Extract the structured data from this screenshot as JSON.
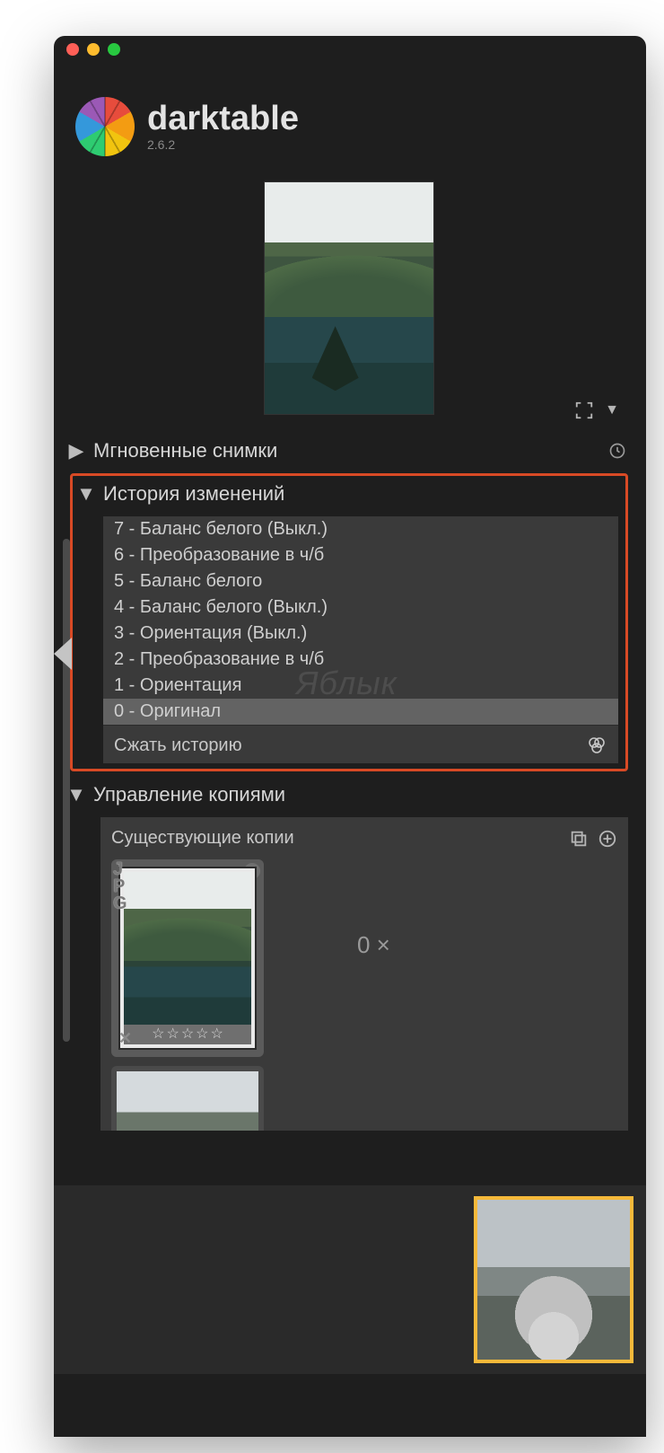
{
  "app": {
    "name": "darktable",
    "version": "2.6.2"
  },
  "panels": {
    "snapshots": {
      "title": "Мгновенные снимки",
      "expanded": false
    },
    "history": {
      "title": "История изменений",
      "expanded": true,
      "items": [
        "7 - Баланс белого (Выкл.)",
        "6 - Преобразование в ч/б",
        "5 - Баланс белого",
        "4 - Баланс белого (Выкл.)",
        "3 - Ориентация (Выкл.)",
        "2 - Преобразование в ч/б",
        "1 - Ориентация",
        "0 - Оригинал"
      ],
      "selected_index": 7,
      "compress_label": "Сжать историю"
    },
    "copies": {
      "title": "Управление копиями",
      "expanded": true,
      "existing_label": "Существующие копии",
      "count_display": "0 ×",
      "thumb_format": "JPG",
      "star_rating": 0
    }
  },
  "watermark": "Яблык"
}
